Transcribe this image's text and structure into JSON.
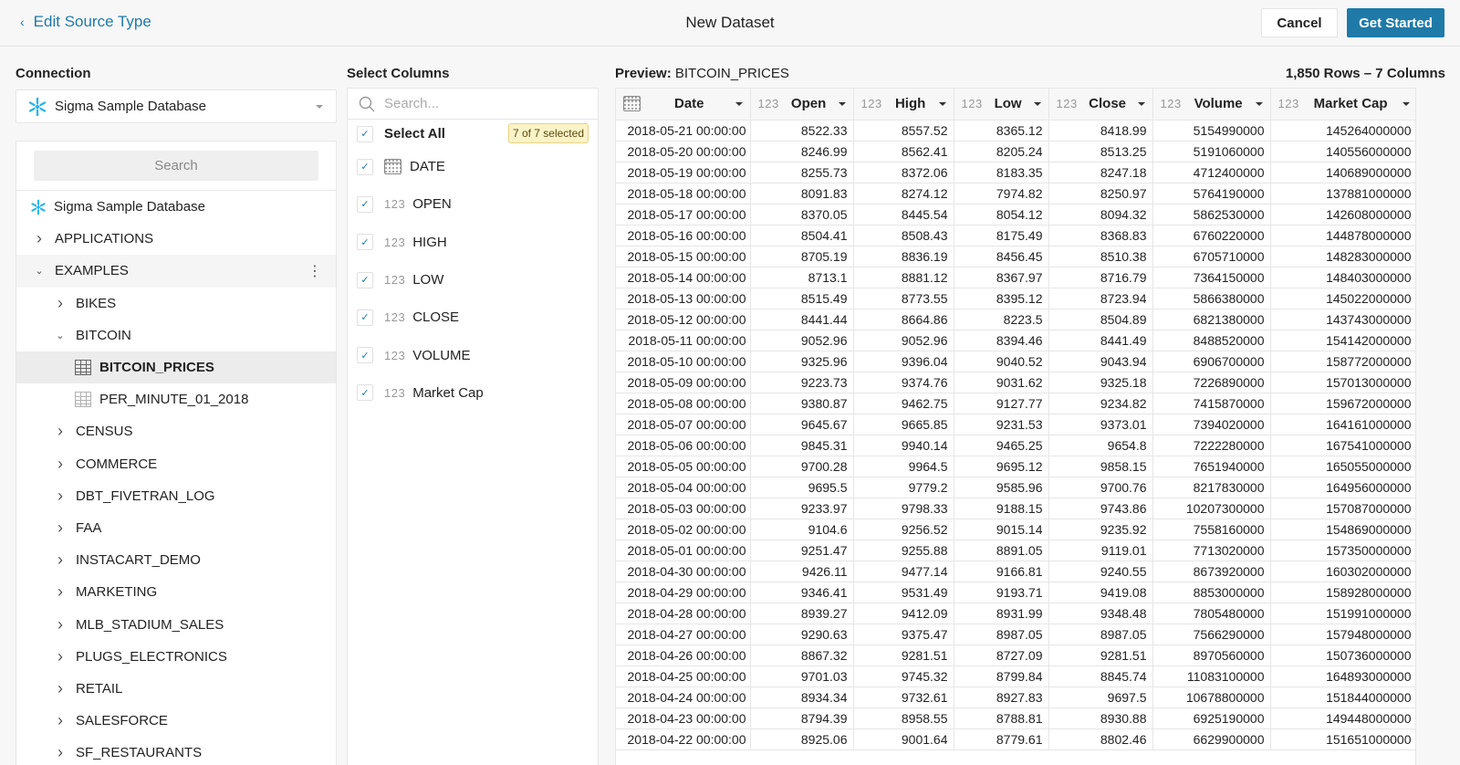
{
  "header": {
    "back_label": "Edit Source Type",
    "title": "New Dataset",
    "cancel_label": "Cancel",
    "primary_label": "Get Started",
    "accent_color": "#1f7aa8"
  },
  "connection": {
    "section_label": "Connection",
    "selected": "Sigma Sample Database",
    "icon": "snowflake-icon"
  },
  "tree": {
    "search_label": "Search",
    "items": [
      {
        "label": "Sigma Sample Database",
        "level": 0,
        "kind": "database",
        "icon": "snowflake-icon"
      },
      {
        "label": "APPLICATIONS",
        "level": 1,
        "kind": "schema",
        "expanded": false
      },
      {
        "label": "EXAMPLES",
        "level": 1,
        "kind": "schema",
        "expanded": true,
        "hover": true
      },
      {
        "label": "BIKES",
        "level": 2,
        "kind": "folder",
        "expanded": false
      },
      {
        "label": "BITCOIN",
        "level": 2,
        "kind": "folder",
        "expanded": true
      },
      {
        "label": "BITCOIN_PRICES",
        "level": 3,
        "kind": "table",
        "selected": true
      },
      {
        "label": "PER_MINUTE_01_2018",
        "level": 3,
        "kind": "table"
      },
      {
        "label": "CENSUS",
        "level": 2,
        "kind": "folder",
        "expanded": false
      },
      {
        "label": "COMMERCE",
        "level": 2,
        "kind": "folder",
        "expanded": false
      },
      {
        "label": "DBT_FIVETRAN_LOG",
        "level": 2,
        "kind": "folder",
        "expanded": false
      },
      {
        "label": "FAA",
        "level": 2,
        "kind": "folder",
        "expanded": false
      },
      {
        "label": "INSTACART_DEMO",
        "level": 2,
        "kind": "folder",
        "expanded": false
      },
      {
        "label": "MARKETING",
        "level": 2,
        "kind": "folder",
        "expanded": false
      },
      {
        "label": "MLB_STADIUM_SALES",
        "level": 2,
        "kind": "folder",
        "expanded": false
      },
      {
        "label": "PLUGS_ELECTRONICS",
        "level": 2,
        "kind": "folder",
        "expanded": false
      },
      {
        "label": "RETAIL",
        "level": 2,
        "kind": "folder",
        "expanded": false
      },
      {
        "label": "SALESFORCE",
        "level": 2,
        "kind": "folder",
        "expanded": false
      },
      {
        "label": "SF_RESTAURANTS",
        "level": 2,
        "kind": "folder",
        "expanded": false
      }
    ]
  },
  "columns_panel": {
    "section_label": "Select Columns",
    "search_placeholder": "Search...",
    "search_value": "",
    "select_all_label": "Select All",
    "selected_badge": "7 of 7 selected",
    "columns": [
      {
        "name": "DATE",
        "type": "date",
        "checked": true
      },
      {
        "name": "OPEN",
        "type": "123",
        "checked": true
      },
      {
        "name": "HIGH",
        "type": "123",
        "checked": true
      },
      {
        "name": "LOW",
        "type": "123",
        "checked": true
      },
      {
        "name": "CLOSE",
        "type": "123",
        "checked": true
      },
      {
        "name": "VOLUME",
        "type": "123",
        "checked": true
      },
      {
        "name": "Market Cap",
        "type": "123",
        "checked": true
      }
    ]
  },
  "preview": {
    "label": "Preview:",
    "table_name": "BITCOIN_PRICES",
    "meta": "1,850 Rows – 7 Columns",
    "headers": [
      {
        "name": "Date",
        "type": "date"
      },
      {
        "name": "Open",
        "type": "123"
      },
      {
        "name": "High",
        "type": "123"
      },
      {
        "name": "Low",
        "type": "123"
      },
      {
        "name": "Close",
        "type": "123"
      },
      {
        "name": "Volume",
        "type": "123"
      },
      {
        "name": "Market Cap",
        "type": "123"
      }
    ],
    "rows": [
      [
        "2018-05-21 00:00:00",
        "8522.33",
        "8557.52",
        "8365.12",
        "8418.99",
        "5154990000",
        "145264000000"
      ],
      [
        "2018-05-20 00:00:00",
        "8246.99",
        "8562.41",
        "8205.24",
        "8513.25",
        "5191060000",
        "140556000000"
      ],
      [
        "2018-05-19 00:00:00",
        "8255.73",
        "8372.06",
        "8183.35",
        "8247.18",
        "4712400000",
        "140689000000"
      ],
      [
        "2018-05-18 00:00:00",
        "8091.83",
        "8274.12",
        "7974.82",
        "8250.97",
        "5764190000",
        "137881000000"
      ],
      [
        "2018-05-17 00:00:00",
        "8370.05",
        "8445.54",
        "8054.12",
        "8094.32",
        "5862530000",
        "142608000000"
      ],
      [
        "2018-05-16 00:00:00",
        "8504.41",
        "8508.43",
        "8175.49",
        "8368.83",
        "6760220000",
        "144878000000"
      ],
      [
        "2018-05-15 00:00:00",
        "8705.19",
        "8836.19",
        "8456.45",
        "8510.38",
        "6705710000",
        "148283000000"
      ],
      [
        "2018-05-14 00:00:00",
        "8713.1",
        "8881.12",
        "8367.97",
        "8716.79",
        "7364150000",
        "148403000000"
      ],
      [
        "2018-05-13 00:00:00",
        "8515.49",
        "8773.55",
        "8395.12",
        "8723.94",
        "5866380000",
        "145022000000"
      ],
      [
        "2018-05-12 00:00:00",
        "8441.44",
        "8664.86",
        "8223.5",
        "8504.89",
        "6821380000",
        "143743000000"
      ],
      [
        "2018-05-11 00:00:00",
        "9052.96",
        "9052.96",
        "8394.46",
        "8441.49",
        "8488520000",
        "154142000000"
      ],
      [
        "2018-05-10 00:00:00",
        "9325.96",
        "9396.04",
        "9040.52",
        "9043.94",
        "6906700000",
        "158772000000"
      ],
      [
        "2018-05-09 00:00:00",
        "9223.73",
        "9374.76",
        "9031.62",
        "9325.18",
        "7226890000",
        "157013000000"
      ],
      [
        "2018-05-08 00:00:00",
        "9380.87",
        "9462.75",
        "9127.77",
        "9234.82",
        "7415870000",
        "159672000000"
      ],
      [
        "2018-05-07 00:00:00",
        "9645.67",
        "9665.85",
        "9231.53",
        "9373.01",
        "7394020000",
        "164161000000"
      ],
      [
        "2018-05-06 00:00:00",
        "9845.31",
        "9940.14",
        "9465.25",
        "9654.8",
        "7222280000",
        "167541000000"
      ],
      [
        "2018-05-05 00:00:00",
        "9700.28",
        "9964.5",
        "9695.12",
        "9858.15",
        "7651940000",
        "165055000000"
      ],
      [
        "2018-05-04 00:00:00",
        "9695.5",
        "9779.2",
        "9585.96",
        "9700.76",
        "8217830000",
        "164956000000"
      ],
      [
        "2018-05-03 00:00:00",
        "9233.97",
        "9798.33",
        "9188.15",
        "9743.86",
        "10207300000",
        "157087000000"
      ],
      [
        "2018-05-02 00:00:00",
        "9104.6",
        "9256.52",
        "9015.14",
        "9235.92",
        "7558160000",
        "154869000000"
      ],
      [
        "2018-05-01 00:00:00",
        "9251.47",
        "9255.88",
        "8891.05",
        "9119.01",
        "7713020000",
        "157350000000"
      ],
      [
        "2018-04-30 00:00:00",
        "9426.11",
        "9477.14",
        "9166.81",
        "9240.55",
        "8673920000",
        "160302000000"
      ],
      [
        "2018-04-29 00:00:00",
        "9346.41",
        "9531.49",
        "9193.71",
        "9419.08",
        "8853000000",
        "158928000000"
      ],
      [
        "2018-04-28 00:00:00",
        "8939.27",
        "9412.09",
        "8931.99",
        "9348.48",
        "7805480000",
        "151991000000"
      ],
      [
        "2018-04-27 00:00:00",
        "9290.63",
        "9375.47",
        "8987.05",
        "8987.05",
        "7566290000",
        "157948000000"
      ],
      [
        "2018-04-26 00:00:00",
        "8867.32",
        "9281.51",
        "8727.09",
        "9281.51",
        "8970560000",
        "150736000000"
      ],
      [
        "2018-04-25 00:00:00",
        "9701.03",
        "9745.32",
        "8799.84",
        "8845.74",
        "11083100000",
        "164893000000"
      ],
      [
        "2018-04-24 00:00:00",
        "8934.34",
        "9732.61",
        "8927.83",
        "9697.5",
        "10678800000",
        "151844000000"
      ],
      [
        "2018-04-23 00:00:00",
        "8794.39",
        "8958.55",
        "8788.81",
        "8930.88",
        "6925190000",
        "149448000000"
      ],
      [
        "2018-04-22 00:00:00",
        "8925.06",
        "9001.64",
        "8779.61",
        "8802.46",
        "6629900000",
        "151651000000"
      ]
    ]
  }
}
